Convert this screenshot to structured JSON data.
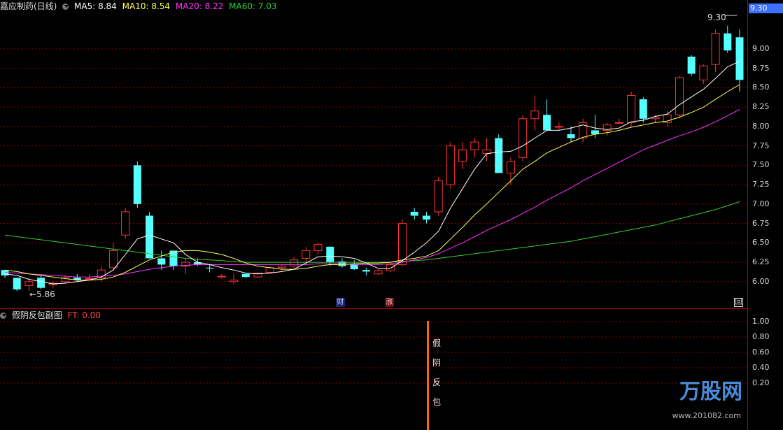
{
  "header": {
    "title": "嘉应制药(日线)",
    "ma5": "MA5: 8.84",
    "ma10": "MA10: 8.54",
    "ma20": "MA20: 8.22",
    "ma60": "MA60: 7.03"
  },
  "sub_header": {
    "title": "假阴反包副图",
    "ft": "FT: 0.00"
  },
  "price_axis": [
    "9.00",
    "8.75",
    "8.50",
    "8.25",
    "8.00",
    "7.75",
    "7.50",
    "7.25",
    "7.00",
    "6.75",
    "6.50",
    "6.25",
    "6.00"
  ],
  "sub_axis": [
    "1.00",
    "0.80",
    "0.60",
    "0.40",
    "0.20"
  ],
  "current_price": "9.30",
  "high_label": "9.30",
  "low_label": "5.86",
  "badges": {
    "cai": "财",
    "zhang": "涨",
    "restore": "回"
  },
  "signal_text": [
    "假",
    "阴",
    "反",
    "包"
  ],
  "watermark": {
    "brand": "万股网",
    "url": "www.201082.com"
  },
  "colors": {
    "up": "#ff3333",
    "down": "#54ffff",
    "ma5": "#ffffff",
    "ma10": "#ffff55",
    "ma20": "#ff33ff",
    "ma60": "#33cc33",
    "grid": "#8b0000",
    "signal": "#ff6600"
  },
  "chart_data": {
    "type": "candlestick",
    "ylim": [
      5.8,
      9.45
    ],
    "candles": [
      [
        6.15,
        6.15,
        6.05,
        6.08
      ],
      [
        6.05,
        6.05,
        5.88,
        5.9
      ],
      [
        5.95,
        6.05,
        5.88,
        6.0
      ],
      [
        6.05,
        6.08,
        5.9,
        5.92
      ],
      [
        5.96,
        6.0,
        5.92,
        5.98
      ],
      [
        6.0,
        6.08,
        5.97,
        6.05
      ],
      [
        6.05,
        6.1,
        6.0,
        6.02
      ],
      [
        6.04,
        6.1,
        6.03,
        6.04
      ],
      [
        6.05,
        6.2,
        6.0,
        6.15
      ],
      [
        6.18,
        6.5,
        6.15,
        6.4
      ],
      [
        6.6,
        6.95,
        6.55,
        6.9
      ],
      [
        7.5,
        7.55,
        6.95,
        7.0
      ],
      [
        6.85,
        6.9,
        6.3,
        6.3
      ],
      [
        6.3,
        6.4,
        6.15,
        6.22
      ],
      [
        6.4,
        6.4,
        6.15,
        6.2
      ],
      [
        6.2,
        6.3,
        6.1,
        6.25
      ],
      [
        6.25,
        6.3,
        6.2,
        6.22
      ],
      [
        6.18,
        6.22,
        6.12,
        6.17
      ],
      [
        6.06,
        6.1,
        6.04,
        6.07
      ],
      [
        6.0,
        6.1,
        5.96,
        6.02
      ],
      [
        6.1,
        6.1,
        6.05,
        6.06
      ],
      [
        6.06,
        6.12,
        6.05,
        6.11
      ],
      [
        6.12,
        6.2,
        6.1,
        6.18
      ],
      [
        6.18,
        6.22,
        6.15,
        6.2
      ],
      [
        6.2,
        6.32,
        6.18,
        6.28
      ],
      [
        6.3,
        6.45,
        6.25,
        6.4
      ],
      [
        6.4,
        6.5,
        6.35,
        6.48
      ],
      [
        6.45,
        6.45,
        6.2,
        6.25
      ],
      [
        6.26,
        6.3,
        6.18,
        6.2
      ],
      [
        6.22,
        6.28,
        6.15,
        6.16
      ],
      [
        6.15,
        6.18,
        6.08,
        6.13
      ],
      [
        6.1,
        6.16,
        6.08,
        6.14
      ],
      [
        6.14,
        6.25,
        6.12,
        6.22
      ],
      [
        6.22,
        6.8,
        6.2,
        6.75
      ],
      [
        6.9,
        6.95,
        6.8,
        6.85
      ],
      [
        6.85,
        6.9,
        6.75,
        6.8
      ],
      [
        6.9,
        7.35,
        6.85,
        7.3
      ],
      [
        7.25,
        7.8,
        7.2,
        7.75
      ],
      [
        7.55,
        7.8,
        7.45,
        7.7
      ],
      [
        7.7,
        7.85,
        7.6,
        7.8
      ],
      [
        7.65,
        7.85,
        7.55,
        7.7
      ],
      [
        7.85,
        7.9,
        7.4,
        7.4
      ],
      [
        7.4,
        7.6,
        7.25,
        7.55
      ],
      [
        7.6,
        8.15,
        7.55,
        8.1
      ],
      [
        8.1,
        8.4,
        7.95,
        8.2
      ],
      [
        8.15,
        8.35,
        7.95,
        7.95
      ],
      [
        8.0,
        8.05,
        7.95,
        8.0
      ],
      [
        7.9,
        8.0,
        7.8,
        7.85
      ],
      [
        7.85,
        8.1,
        7.8,
        8.05
      ],
      [
        7.95,
        8.15,
        7.85,
        7.9
      ],
      [
        7.95,
        8.05,
        7.88,
        8.02
      ],
      [
        8.05,
        8.1,
        8.03,
        8.05
      ],
      [
        8.05,
        8.45,
        8.0,
        8.4
      ],
      [
        8.35,
        8.38,
        8.05,
        8.1
      ],
      [
        8.1,
        8.15,
        8.05,
        8.12
      ],
      [
        8.05,
        8.2,
        8.0,
        8.15
      ],
      [
        8.15,
        8.65,
        8.1,
        8.63
      ],
      [
        8.9,
        8.92,
        8.65,
        8.68
      ],
      [
        8.6,
        8.8,
        8.55,
        8.78
      ],
      [
        8.8,
        9.25,
        8.7,
        9.2
      ],
      [
        9.2,
        9.3,
        8.95,
        8.98
      ],
      [
        9.15,
        9.25,
        8.45,
        8.6
      ]
    ],
    "ma5": [
      6.1,
      6.08,
      6.03,
      6.0,
      5.97,
      5.98,
      6.0,
      6.02,
      6.06,
      6.15,
      6.35,
      6.55,
      6.6,
      6.55,
      6.5,
      6.35,
      6.25,
      6.22,
      6.18,
      6.15,
      6.11,
      6.1,
      6.11,
      6.13,
      6.16,
      6.24,
      6.32,
      6.33,
      6.32,
      6.3,
      6.24,
      6.17,
      6.17,
      6.27,
      6.38,
      6.5,
      6.65,
      6.95,
      7.2,
      7.45,
      7.65,
      7.67,
      7.68,
      7.75,
      7.85,
      7.95,
      7.95,
      7.98,
      8.02,
      7.98,
      7.96,
      7.98,
      8.06,
      8.08,
      8.13,
      8.16,
      8.28,
      8.38,
      8.48,
      8.62,
      8.77,
      8.84
    ],
    "ma10": [
      6.15,
      6.13,
      6.1,
      6.08,
      6.06,
      6.04,
      6.02,
      6.02,
      6.03,
      6.06,
      6.12,
      6.2,
      6.28,
      6.33,
      6.38,
      6.4,
      6.4,
      6.38,
      6.35,
      6.3,
      6.24,
      6.2,
      6.18,
      6.16,
      6.16,
      6.17,
      6.2,
      6.22,
      6.22,
      6.23,
      6.24,
      6.24,
      6.25,
      6.28,
      6.3,
      6.33,
      6.4,
      6.55,
      6.7,
      6.86,
      7.0,
      7.15,
      7.3,
      7.45,
      7.55,
      7.66,
      7.73,
      7.8,
      7.86,
      7.9,
      7.92,
      7.95,
      7.99,
      8.02,
      8.05,
      8.07,
      8.12,
      8.18,
      8.25,
      8.35,
      8.45,
      8.54
    ],
    "ma20": [
      6.12,
      6.11,
      6.1,
      6.09,
      6.08,
      6.07,
      6.06,
      6.06,
      6.07,
      6.08,
      6.1,
      6.13,
      6.16,
      6.18,
      6.2,
      6.21,
      6.22,
      6.22,
      6.22,
      6.22,
      6.22,
      6.22,
      6.22,
      6.22,
      6.22,
      6.22,
      6.23,
      6.23,
      6.23,
      6.22,
      6.22,
      6.22,
      6.23,
      6.25,
      6.28,
      6.31,
      6.36,
      6.43,
      6.5,
      6.58,
      6.66,
      6.73,
      6.8,
      6.88,
      6.96,
      7.05,
      7.13,
      7.21,
      7.3,
      7.38,
      7.46,
      7.54,
      7.62,
      7.7,
      7.76,
      7.82,
      7.88,
      7.93,
      7.99,
      8.06,
      8.14,
      8.22
    ],
    "ma60": [
      6.6,
      6.58,
      6.56,
      6.54,
      6.52,
      6.5,
      6.48,
      6.46,
      6.44,
      6.42,
      6.4,
      6.38,
      6.36,
      6.34,
      6.32,
      6.3,
      6.29,
      6.28,
      6.27,
      6.26,
      6.25,
      6.25,
      6.25,
      6.25,
      6.25,
      6.25,
      6.25,
      6.25,
      6.25,
      6.25,
      6.25,
      6.25,
      6.25,
      6.26,
      6.27,
      6.28,
      6.3,
      6.32,
      6.34,
      6.36,
      6.38,
      6.4,
      6.42,
      6.44,
      6.46,
      6.48,
      6.5,
      6.52,
      6.55,
      6.58,
      6.61,
      6.64,
      6.67,
      6.7,
      6.73,
      6.77,
      6.81,
      6.85,
      6.89,
      6.93,
      6.98,
      7.03
    ]
  }
}
